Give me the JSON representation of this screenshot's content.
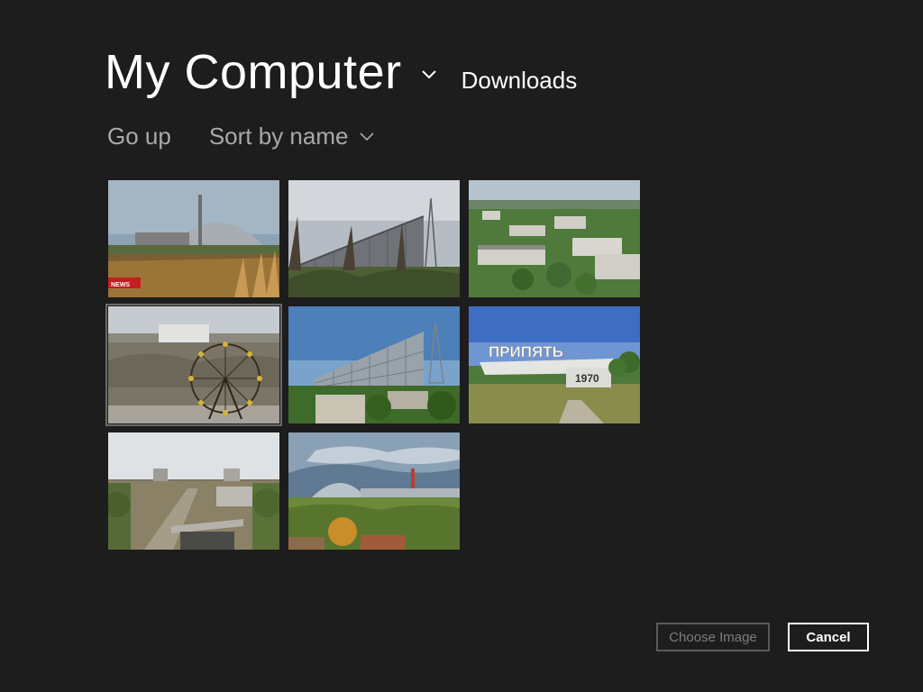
{
  "header": {
    "location_title": "My Computer",
    "subfolder": "Downloads"
  },
  "commands": {
    "go_up": "Go up",
    "sort": "Sort by name"
  },
  "thumbnails": [
    {
      "overlay_text": "NEWS",
      "selected": false
    },
    {
      "selected": false
    },
    {
      "selected": false
    },
    {
      "selected": true
    },
    {
      "selected": false
    },
    {
      "sign_text": "ПРИПЯТЬ",
      "sign_year": "1970",
      "selected": false
    },
    {
      "selected": false
    },
    {
      "selected": false
    }
  ],
  "buttons": {
    "choose": "Choose Image",
    "cancel": "Cancel"
  },
  "colors": {
    "background": "#1d1d1d",
    "text": "#ffffff",
    "muted_text": "#a9a9a9",
    "disabled_text": "#7d7d7d"
  }
}
